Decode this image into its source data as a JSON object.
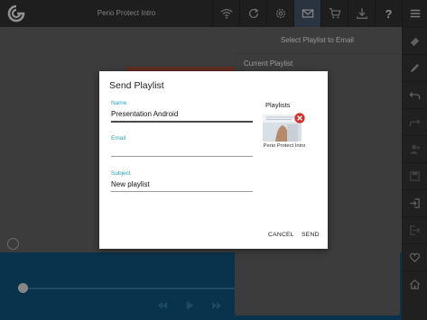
{
  "app": {
    "title": "Perio Protect Intro"
  },
  "toolbar": {
    "buttons": [
      {
        "name": "wifi-icon",
        "active": false
      },
      {
        "name": "refresh-icon",
        "active": false
      },
      {
        "name": "gear-icon",
        "active": false
      },
      {
        "name": "mail-icon",
        "active": true
      },
      {
        "name": "cart-icon",
        "active": false
      },
      {
        "name": "download-icon",
        "active": false
      },
      {
        "name": "help-icon",
        "active": false,
        "text": "?"
      },
      {
        "name": "menu-icon",
        "active": false
      }
    ]
  },
  "panel": {
    "header": "Select Playlist to Email",
    "current_playlist_label": "Current Playlist"
  },
  "dialog": {
    "title": "Send Playlist",
    "fields": {
      "name": {
        "label": "Name",
        "value": "Presentation Android"
      },
      "email": {
        "label": "Email",
        "value": ""
      },
      "subject": {
        "label": "Subject",
        "value": "New playlist"
      }
    },
    "playlists_heading": "Playlists",
    "playlist_items": [
      {
        "label": "Perio Protect Intro"
      }
    ],
    "cancel_label": "CANCEL",
    "send_label": "SEND"
  },
  "sidebar": {
    "buttons": [
      "eraser-icon",
      "pencil-icon",
      "undo-icon",
      "redo-icon",
      "add-user-icon",
      "save-icon",
      "login-icon",
      "logout-icon",
      "heart-icon",
      "home-icon"
    ]
  },
  "player": {
    "progress": 0,
    "controls": [
      "previous-icon",
      "play-icon",
      "next-icon"
    ]
  },
  "colors": {
    "accent": "#2aa2b6",
    "toolbar": "#2c2c2c",
    "toolbar_active": "#3d4b5e",
    "player": "#0e4a6e",
    "remove": "#d0312d"
  }
}
